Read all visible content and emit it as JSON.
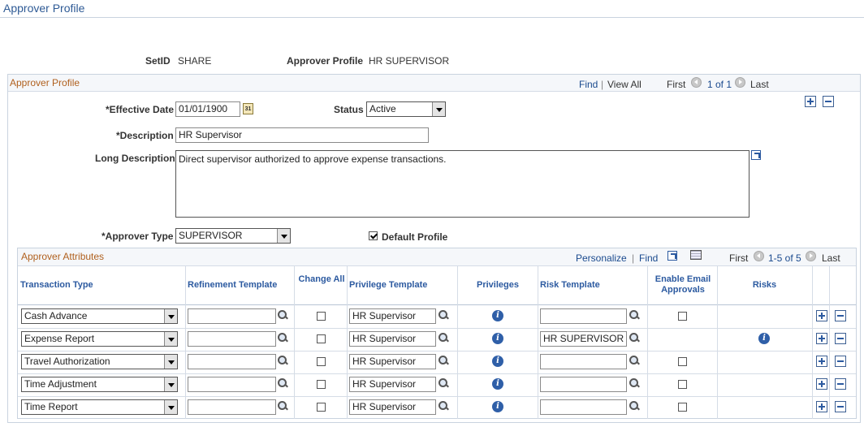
{
  "page": {
    "title": "Approver Profile"
  },
  "key_fields": {
    "setid_label": "SetID",
    "setid_value": "SHARE",
    "approver_profile_label": "Approver Profile",
    "approver_profile_value": "HR SUPERVISOR"
  },
  "profile_section": {
    "title": "Approver Profile",
    "find": "Find",
    "separator": "|",
    "view_all": "View All",
    "first": "First",
    "count": "1 of 1",
    "last": "Last",
    "effective_date_label": "*Effective Date",
    "effective_date_value": "01/01/1900",
    "calendar_glyph": "31",
    "status_label": "Status",
    "status_value": "Active",
    "description_label": "*Description",
    "description_value": "HR Supervisor",
    "long_description_label": "Long Description",
    "long_description_value": "Direct supervisor authorized to approve expense transactions.",
    "approver_type_label": "*Approver Type",
    "approver_type_value": "SUPERVISOR",
    "default_profile_label": "Default Profile",
    "default_profile_checked": true
  },
  "attributes": {
    "title": "Approver Attributes",
    "personalize": "Personalize",
    "find": "Find",
    "separator": "|",
    "first": "First",
    "count": "1-5 of 5",
    "last": "Last",
    "columns": {
      "transaction_type": "Transaction Type",
      "refinement_template": "Refinement Template",
      "change_all": "Change All",
      "privilege_template": "Privilege Template",
      "privileges": "Privileges",
      "risk_template": "Risk Template",
      "enable_email": "Enable Email Approvals",
      "risks": "Risks"
    },
    "rows": [
      {
        "transaction_type": "Cash Advance",
        "refinement_template": "",
        "change_all": false,
        "privilege_template": "HR Supervisor",
        "risk_template": "",
        "enable_email": false,
        "has_email_checkbox": true,
        "has_risk_info": false
      },
      {
        "transaction_type": "Expense Report",
        "refinement_template": "",
        "change_all": false,
        "privilege_template": "HR Supervisor",
        "risk_template": "HR SUPERVISOR",
        "enable_email": false,
        "has_email_checkbox": false,
        "has_risk_info": true
      },
      {
        "transaction_type": "Travel Authorization",
        "refinement_template": "",
        "change_all": false,
        "privilege_template": "HR Supervisor",
        "risk_template": "",
        "enable_email": false,
        "has_email_checkbox": true,
        "has_risk_info": false
      },
      {
        "transaction_type": "Time Adjustment",
        "refinement_template": "",
        "change_all": false,
        "privilege_template": "HR Supervisor",
        "risk_template": "",
        "enable_email": false,
        "has_email_checkbox": true,
        "has_risk_info": false
      },
      {
        "transaction_type": "Time Report",
        "refinement_template": "",
        "change_all": false,
        "privilege_template": "HR Supervisor",
        "risk_template": "",
        "enable_email": false,
        "has_email_checkbox": true,
        "has_risk_info": false
      }
    ]
  },
  "icons": {
    "info_glyph": "i"
  }
}
